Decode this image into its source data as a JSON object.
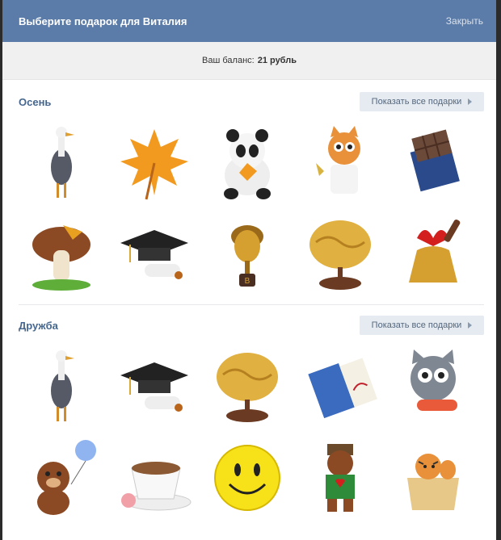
{
  "dialog": {
    "title": "Выберите подарок для Виталия",
    "close_label": "Закрыть",
    "balance_label": "Ваш баланс:",
    "balance_value": "21 рубль"
  },
  "sections": [
    {
      "title": "Осень",
      "show_all_label": "Показать все подарки",
      "gifts_row1": [
        "stork-gift-icon",
        "maple-leaf-gift-icon",
        "panda-gift-icon",
        "cat-maid-gift-icon",
        "chocolate-book-gift-icon"
      ],
      "gifts_row2": [
        "mushroom-gift-icon",
        "graduation-cap-gift-icon",
        "golden-acorn-gift-icon",
        "golden-brain-gift-icon",
        "bell-bow-gift-icon"
      ]
    },
    {
      "title": "Дружба",
      "show_all_label": "Показать все подарки",
      "gifts_row1": [
        "stork-gift-icon",
        "graduation-cap-gift-icon",
        "golden-brain-gift-icon",
        "record-book-gift-icon",
        "cat-fish-gift-icon"
      ],
      "gifts_row2": [
        "bear-balloon-gift-icon",
        "coffee-cup-gift-icon",
        "smiley-gift-icon",
        "moscow-bear-gift-icon",
        "tiger-box-gift-icon"
      ]
    }
  ],
  "colors": {
    "header_bg": "#5b7ba8",
    "section_title": "#45668e",
    "button_bg": "#e5ebf1"
  }
}
